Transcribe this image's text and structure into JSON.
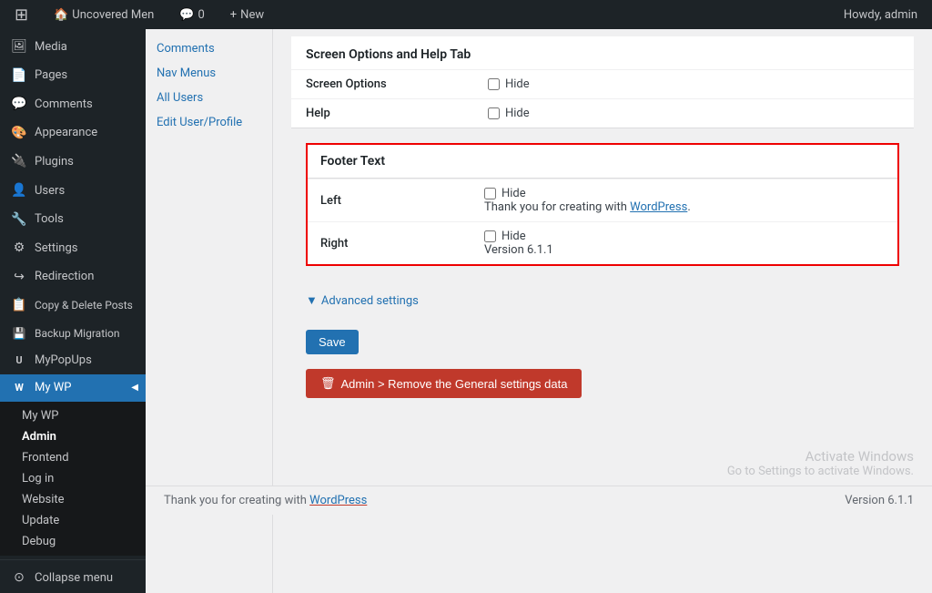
{
  "adminbar": {
    "site_name": "Uncovered Men",
    "new_label": "New",
    "comments_count": "0",
    "howdy": "Howdy, admin"
  },
  "sidebar": {
    "items": [
      {
        "id": "media",
        "icon": "🖼",
        "label": "Media"
      },
      {
        "id": "pages",
        "icon": "📄",
        "label": "Pages"
      },
      {
        "id": "comments",
        "icon": "💬",
        "label": "Comments"
      },
      {
        "id": "appearance",
        "icon": "🎨",
        "label": "Appearance"
      },
      {
        "id": "plugins",
        "icon": "🔌",
        "label": "Plugins"
      },
      {
        "id": "users",
        "icon": "👤",
        "label": "Users"
      },
      {
        "id": "tools",
        "icon": "🔧",
        "label": "Tools"
      },
      {
        "id": "settings",
        "icon": "⚙",
        "label": "Settings"
      },
      {
        "id": "redirection",
        "icon": "↪",
        "label": "Redirection"
      },
      {
        "id": "copy-delete",
        "icon": "📋",
        "label": "Copy & Delete Posts"
      },
      {
        "id": "backup-migration",
        "icon": "💾",
        "label": "Backup Migration"
      },
      {
        "id": "mypopups",
        "icon": "U",
        "label": "MyPopUps"
      },
      {
        "id": "mywp",
        "icon": "W",
        "label": "My WP",
        "active": true
      }
    ],
    "mywp_submenu": [
      {
        "id": "mywp-sub",
        "label": "My WP"
      },
      {
        "id": "admin-sub",
        "label": "Admin",
        "active": true
      },
      {
        "id": "frontend-sub",
        "label": "Frontend"
      },
      {
        "id": "login-sub",
        "label": "Log in"
      },
      {
        "id": "website-sub",
        "label": "Website"
      },
      {
        "id": "update-sub",
        "label": "Update"
      },
      {
        "id": "debug-sub",
        "label": "Debug"
      }
    ],
    "collapse_label": "Collapse menu"
  },
  "sub_sidebar": {
    "items": [
      {
        "id": "comments-sub",
        "label": "Comments"
      },
      {
        "id": "nav-menus-sub",
        "label": "Nav Menus"
      },
      {
        "id": "all-users-sub",
        "label": "All Users"
      },
      {
        "id": "edit-user-sub",
        "label": "Edit User/Profile"
      }
    ]
  },
  "screen_options": {
    "title": "Screen Options and Help Tab",
    "rows": [
      {
        "label": "Screen Options",
        "checkbox_checked": false,
        "hide_label": "Hide"
      },
      {
        "label": "Help",
        "checkbox_checked": false,
        "hide_label": "Hide"
      }
    ]
  },
  "footer_text": {
    "title": "Footer Text",
    "rows": [
      {
        "label": "Left",
        "checkbox_checked": false,
        "hide_label": "Hide",
        "value_before": "Thank you for creating with ",
        "link_text": "WordPress",
        "value_after": "."
      },
      {
        "label": "Right",
        "checkbox_checked": false,
        "hide_label": "Hide",
        "value": "Version 6.1.1"
      }
    ]
  },
  "advanced_settings": {
    "label": "Advanced settings"
  },
  "buttons": {
    "save_label": "Save",
    "delete_label": "Admin > Remove the General settings data"
  },
  "footer": {
    "left_text": "Thank you for creating with ",
    "left_link": "WordPress",
    "right_text": "Version 6.1.1"
  },
  "activate_windows": {
    "title": "Activate Windows",
    "subtitle": "Go to Settings to activate Windows."
  }
}
